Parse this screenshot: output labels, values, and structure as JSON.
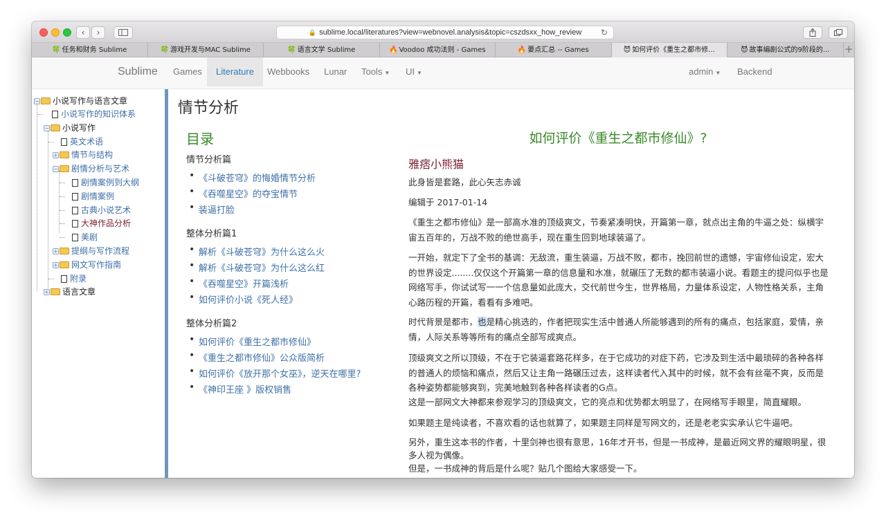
{
  "browser": {
    "url": "sublime.local/literatures?view=webnovel.analysis&topic=cszdsxx_how_review",
    "tabs": [
      {
        "icon": "🍀",
        "label": "任务和财务 Sublime"
      },
      {
        "icon": "🍀",
        "label": "游戏开发与MAC Sublime"
      },
      {
        "icon": "🍀",
        "label": "语言文学 Sublime"
      },
      {
        "icon": "🔥",
        "label": "Voodoo 成功法则 - Games"
      },
      {
        "icon": "🔥",
        "label": "要点汇总 -- Games"
      },
      {
        "icon": "😈",
        "label": "如何评价《重生之都市修..."
      },
      {
        "icon": "😈",
        "label": "故事编剧公式的9阶段的..."
      }
    ]
  },
  "nav": {
    "brand": "Sublime",
    "items": [
      "Games",
      "Literature",
      "Webbooks",
      "Lunar",
      "Tools",
      "UI"
    ],
    "active": "Literature",
    "user": "admin",
    "backend": "Backend"
  },
  "tree": {
    "root": "小说写作与语言文章",
    "n1": "小说写作的知识体系",
    "n2": "小说写作",
    "n3": "英文术语",
    "n4": "情节与结构",
    "n5": "剧情分析与艺术",
    "n6": "剧情案例到大纲",
    "n7": "剧情案例",
    "n8": "古典小说艺术",
    "n9": "大神作品分析",
    "n10": "美剧",
    "n11": "提纲与写作流程",
    "n12": "网文写作指南",
    "n13": "附录",
    "n14": "语言文章"
  },
  "content": {
    "page_title": "情节分析",
    "toc_title": "目录",
    "sec1": "情节分析篇",
    "sec1_items": [
      "《斗破苍穹》的悔婚情节分析",
      "《吞噬星空》的夺宝情节",
      "装逼打脸"
    ],
    "sec2": "整体分析篇1",
    "sec2_items": [
      "解析《斗破苍穹》为什么这么火",
      "解析《斗破苍穹》为什么这么红",
      "《吞噬星空》开篇浅析",
      "如何评价小说《死人经》"
    ],
    "sec3": "整体分析篇2",
    "sec3_items": [
      "如何评价《重生之都市修仙》",
      "《重生之都市修仙》公众版简析",
      "如何评价《放开那个女巫》，逆天在哪里?",
      "《神印王座 》版权销售"
    ]
  },
  "article": {
    "title": "如何评价《重生之都市修仙》?",
    "author": "雅痞小熊猫",
    "tagline": "此身皆是套路，此心矢志赤诚",
    "edited": "编辑于 2017-01-14",
    "p1": "《重生之都市修仙》是一部高水准的顶级爽文，节奏紧凑明快，开篇第一章，就点出主角的牛逼之处：纵横宇宙五百年的，万战不败的绝世高手，现在重生回到地球装逼了。",
    "p2": "一开始，就定下了全书的基调：无敌流，重生装逼，万战不败，都市，挽回前世的遗憾，宇宙修仙设定，宏大的世界设定........仅仅这个开篇第一章的信息量和水准，就碾压了无数的都市装逼小说。看题主的提问似乎也是网络写手，你试试写一一个信息量如此庞大，交代前世今生，世界格局，力量体系设定，人物性格关系，主角心路历程的开篇，看看有多难吧。",
    "p3a": "时代背景是都市，",
    "p3hl": "也",
    "p3b": "是精心挑选的，作者把现实生活中普通人所能够遇到的所有的痛点，包括家庭，爱情，亲情，人际关系等等所有的痛点全部写成爽点。",
    "p4": "顶级爽文之所以顶级，不在于它装逼套路花样多，在于它成功的对症下药，它涉及到生活中最琐碎的各种各样的普通人的烦恼和痛点，然后又让主角一路碾压过去，这样读者代入其中的时候，就不会有丝毫不爽，反而是各种姿势都能够爽到，完美地触到各种各样读者的G点。",
    "p5": "这是一部网文大神都来参观学习的顶级爽文，它的亮点和优势都太明显了，在网络写手眼里，简直耀眼。",
    "p6": "如果题主是纯读者，不喜欢看的话也就算了，如果题主同样是写网文的，还是老老实实承认它牛逼吧。",
    "p7": "另外，重生这本书的作者，十里剑神也很有意思，16年才开书，但是一书成神，是最近网文界的耀眼明星，很多人视为偶像。",
    "p8": "但是，一书成神的背后是什么呢？贴几个图给大家感受一下。"
  }
}
